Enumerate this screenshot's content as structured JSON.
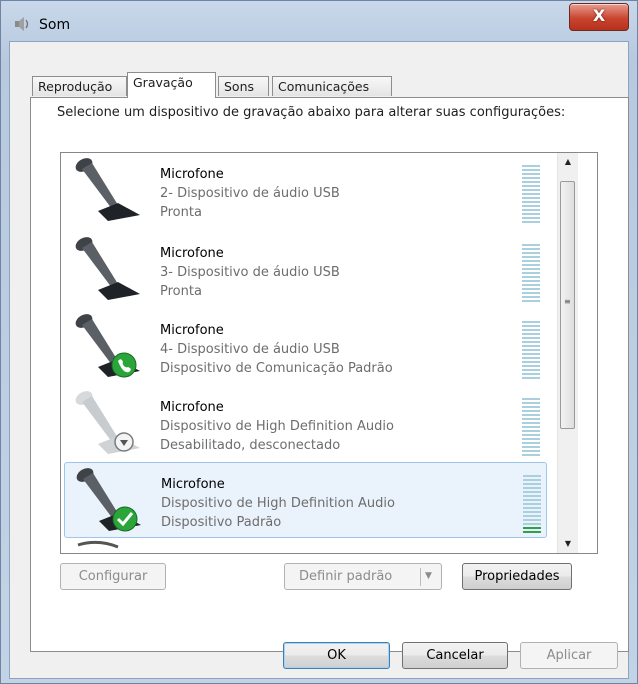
{
  "window": {
    "title": "Som",
    "close_glyph": "X"
  },
  "tabs": [
    {
      "label": "Reprodução"
    },
    {
      "label": "Gravação"
    },
    {
      "label": "Sons"
    },
    {
      "label": "Comunicações"
    }
  ],
  "instruction": "Selecione um dispositivo de gravação abaixo para alterar suas configurações:",
  "devices": [
    {
      "name": "Microfone",
      "description": "2- Dispositivo de áudio USB",
      "status": "Pronta",
      "badge": "none",
      "level_segments_on": 0
    },
    {
      "name": "Microfone",
      "description": "3- Dispositivo de áudio USB",
      "status": "Pronta",
      "badge": "none",
      "level_segments_on": 0
    },
    {
      "name": "Microfone",
      "description": "4- Dispositivo de áudio USB",
      "status": "Dispositivo de Comunicação Padrão",
      "badge": "phone-icon",
      "level_segments_on": 0
    },
    {
      "name": "Microfone",
      "description": "Dispositivo de High Definition Audio",
      "status": "Desabilitado, desconectado",
      "badge": "down-arrow-icon",
      "level_segments_on": 0
    },
    {
      "name": "Microfone",
      "description": "Dispositivo de High Definition Audio",
      "status": "Dispositivo Padrão",
      "badge": "check-icon",
      "level_segments_on": 2,
      "selected": true
    }
  ],
  "buttons": {
    "configure": "Configurar",
    "set_default": "Definir padrão",
    "properties": "Propriedades",
    "ok": "OK",
    "cancel": "Cancelar",
    "apply": "Aplicar"
  },
  "colors": {
    "meter_off": "#aad0de",
    "meter_on": "#2ea24a",
    "badge_green": "#2aa53a",
    "close_red": "#c9452f"
  }
}
